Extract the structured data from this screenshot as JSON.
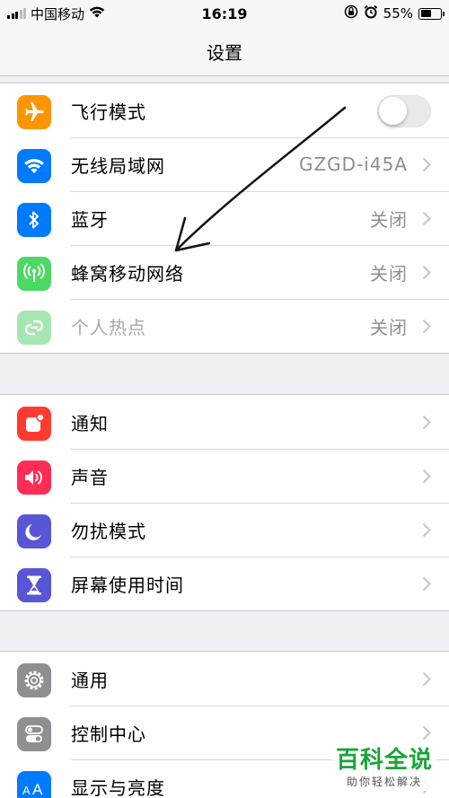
{
  "status_bar": {
    "carrier": "中国移动",
    "time": "16:19",
    "battery_percent": "55%",
    "battery_level": 0.55
  },
  "nav": {
    "title": "设置"
  },
  "groups": [
    {
      "rows": [
        {
          "label": "飞行模式",
          "icon": "airplane-icon",
          "icon_color": "#ff9500",
          "control": "toggle",
          "toggle_on": false
        },
        {
          "label": "无线局域网",
          "icon": "wifi-icon",
          "icon_color": "#007aff",
          "value": "GZGD-i45A"
        },
        {
          "label": "蓝牙",
          "icon": "bluetooth-icon",
          "icon_color": "#007aff",
          "value": "关闭"
        },
        {
          "label": "蜂窝移动网络",
          "icon": "cellular-icon",
          "icon_color": "#4cd964",
          "value": "关闭"
        },
        {
          "label": "个人热点",
          "icon": "hotspot-icon",
          "icon_color": "#a6e6b2",
          "value": "关闭",
          "disabled": true
        }
      ]
    },
    {
      "rows": [
        {
          "label": "通知",
          "icon": "notification-icon",
          "icon_color": "#ff3b30"
        },
        {
          "label": "声音",
          "icon": "sound-icon",
          "icon_color": "#ff2d55"
        },
        {
          "label": "勿扰模式",
          "icon": "moon-icon",
          "icon_color": "#5856d6"
        },
        {
          "label": "屏幕使用时间",
          "icon": "hourglass-icon",
          "icon_color": "#5856d6"
        }
      ]
    },
    {
      "rows": [
        {
          "label": "通用",
          "icon": "gear-icon",
          "icon_color": "#8e8e93"
        },
        {
          "label": "控制中心",
          "icon": "switches-icon",
          "icon_color": "#8e8e93"
        },
        {
          "label": "显示与亮度",
          "icon": "text-size-icon",
          "icon_color": "#007aff"
        }
      ]
    }
  ],
  "watermark": {
    "title": "百科全说",
    "subtitle": "助你轻松解决"
  }
}
